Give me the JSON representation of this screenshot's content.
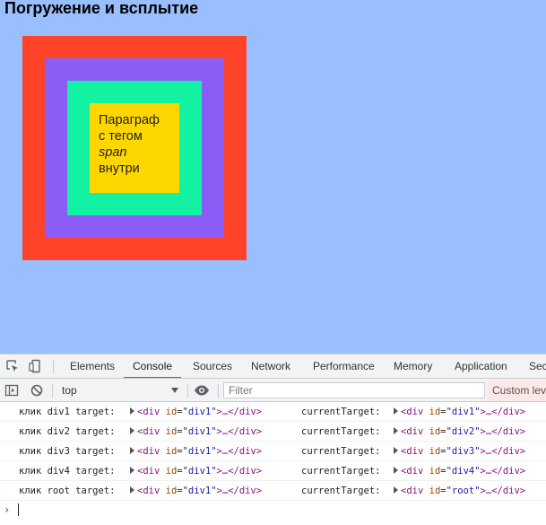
{
  "page": {
    "title": "Погружение и всплытие",
    "paragraph": {
      "line1": "Параграф",
      "line2": "с тегом",
      "line3_em": "span",
      "line4": "внутри"
    },
    "colors": {
      "background": "#99bfff",
      "root": "#ff4329",
      "div1": "#8b5cf6",
      "div2": "#13f2a3",
      "div3": "#ffd700"
    }
  },
  "devtools": {
    "tabs": [
      {
        "label": "Elements"
      },
      {
        "label": "Console"
      },
      {
        "label": "Sources"
      },
      {
        "label": "Network"
      },
      {
        "label": "Performance"
      },
      {
        "label": "Memory"
      },
      {
        "label": "Application"
      },
      {
        "label": "Sec"
      }
    ],
    "active_tab": "Console",
    "icons": {
      "inspect": "inspect-element-icon",
      "device": "device-toggle-icon",
      "sidebar": "console-sidebar-icon",
      "clear": "clear-console-icon",
      "eye": "live-expression-icon",
      "dropdown": "chevron-down-icon",
      "prompt": "prompt-chevron-icon"
    },
    "context": "top",
    "filter_placeholder": "Filter",
    "levels_label": "Custom lev",
    "console": {
      "rows": [
        {
          "label": "клик div1 target:",
          "t_tag_open": "<div",
          "t_attr": "id",
          "t_val": "\"div1\"",
          "t_rest": ">…</div>",
          "ct_label": "currentTarget:",
          "ct_tag_open": "<div",
          "ct_attr": "id",
          "ct_val": "\"div1\"",
          "ct_rest": ">…</div>"
        },
        {
          "label": "клик div2 target:",
          "t_tag_open": "<div",
          "t_attr": "id",
          "t_val": "\"div1\"",
          "t_rest": ">…</div>",
          "ct_label": "currentTarget:",
          "ct_tag_open": "<div",
          "ct_attr": "id",
          "ct_val": "\"div2\"",
          "ct_rest": ">…</div>"
        },
        {
          "label": "клик div3 target:",
          "t_tag_open": "<div",
          "t_attr": "id",
          "t_val": "\"div1\"",
          "t_rest": ">…</div>",
          "ct_label": "currentTarget:",
          "ct_tag_open": "<div",
          "ct_attr": "id",
          "ct_val": "\"div3\"",
          "ct_rest": ">…</div>"
        },
        {
          "label": "клик div4 target:",
          "t_tag_open": "<div",
          "t_attr": "id",
          "t_val": "\"div1\"",
          "t_rest": ">…</div>",
          "ct_label": "currentTarget:",
          "ct_tag_open": "<div",
          "ct_attr": "id",
          "ct_val": "\"div4\"",
          "ct_rest": ">…</div>"
        },
        {
          "label": "клик root target:",
          "t_tag_open": "<div",
          "t_attr": "id",
          "t_val": "\"div1\"",
          "t_rest": ">…</div>",
          "ct_label": "currentTarget:",
          "ct_tag_open": "<div",
          "ct_attr": "id",
          "ct_val": "\"root\"",
          "ct_rest": ">…</div>"
        }
      ]
    }
  }
}
